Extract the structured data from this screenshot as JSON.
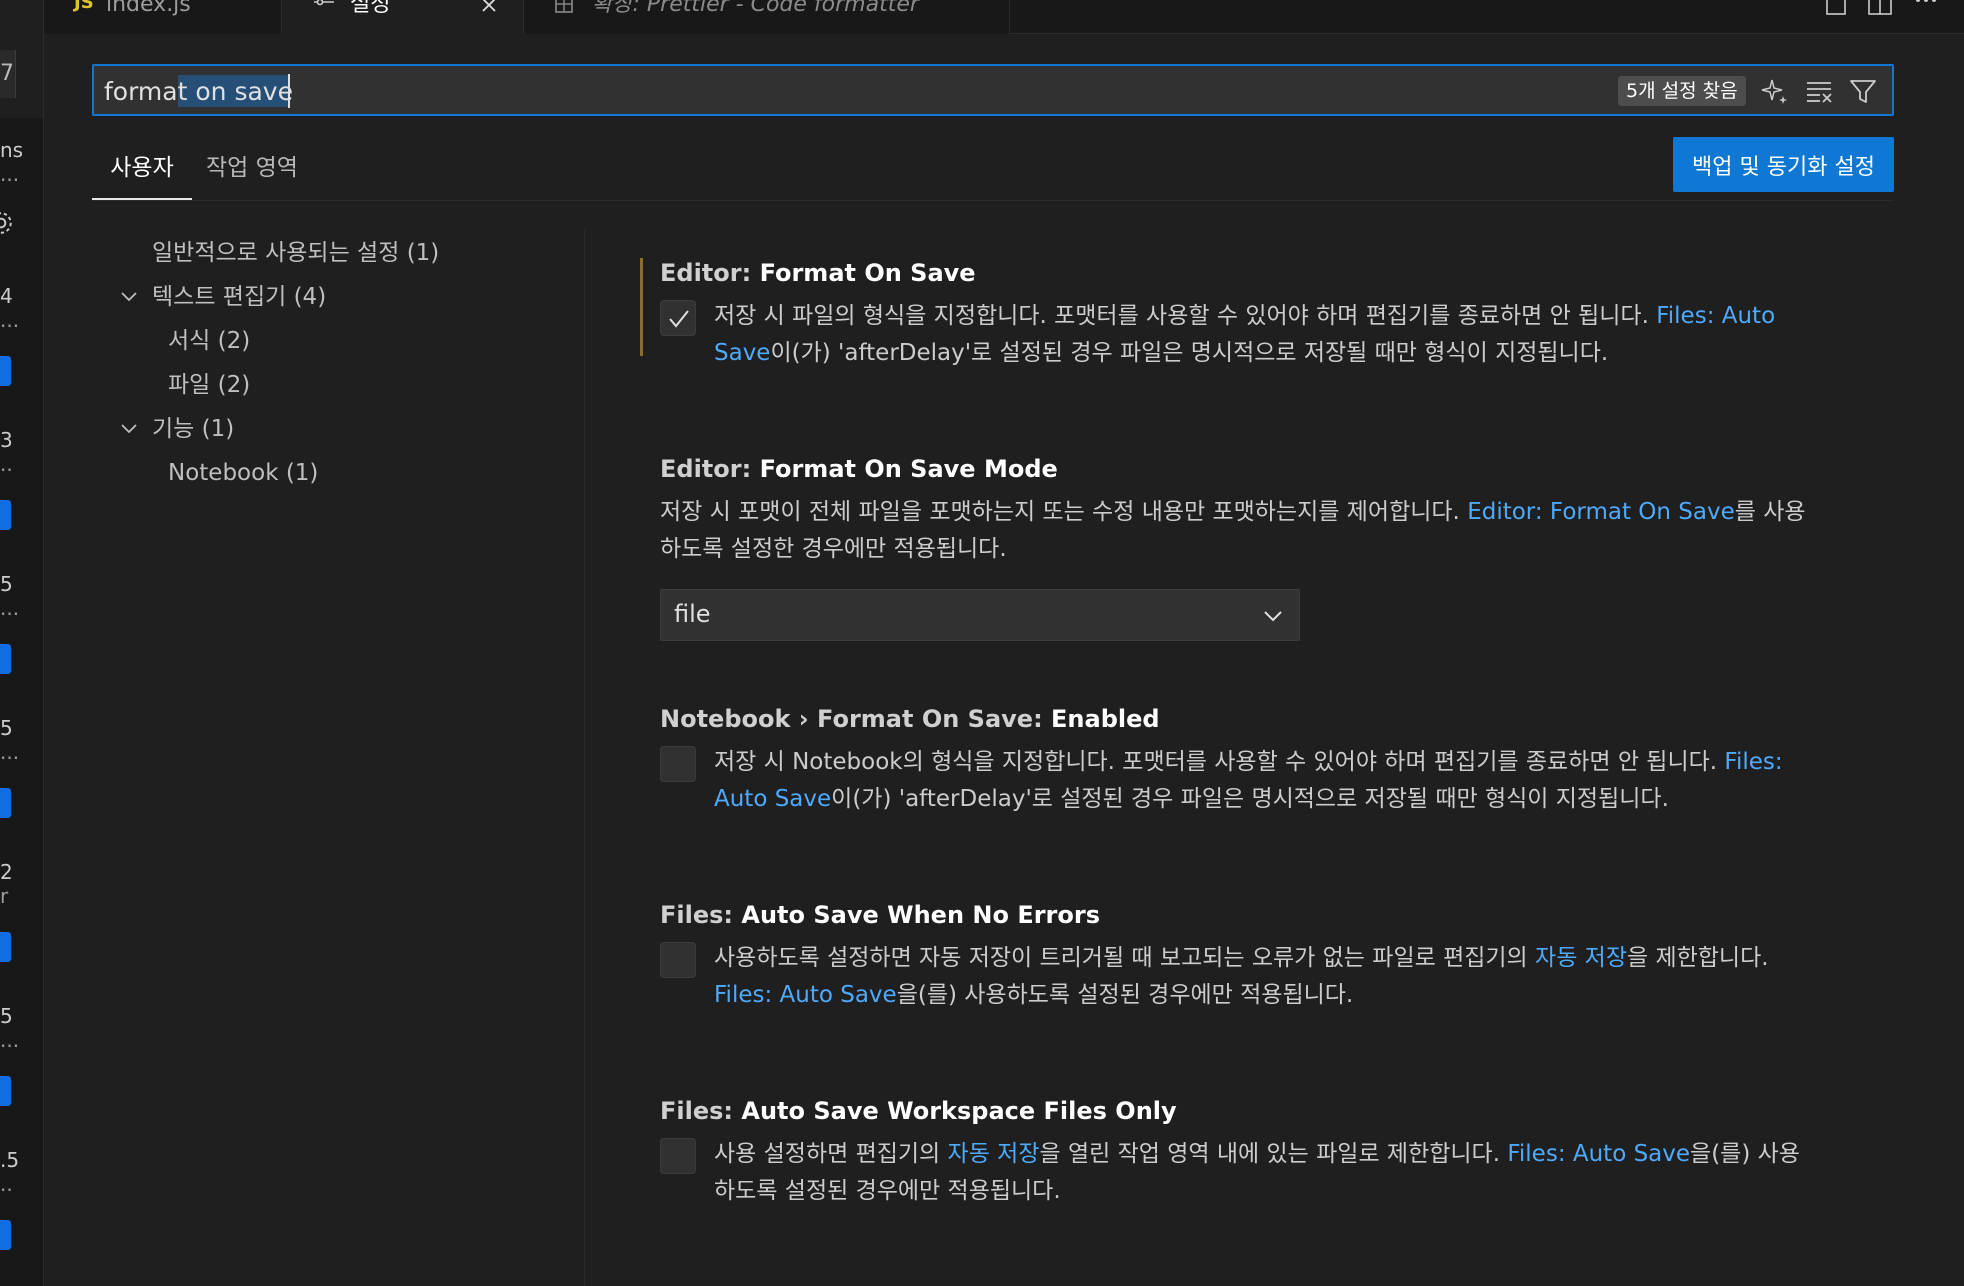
{
  "tabs": [
    {
      "icon": "JS",
      "label": "index.js"
    },
    {
      "label": "설정",
      "close_icon": "close-icon"
    },
    {
      "label": "확장: Prettier - Code formatter"
    }
  ],
  "left_strip": {
    "top_glyph": "7",
    "snippets": [
      {
        "num": "ns",
        "dots": "..."
      },
      {
        "num": "4",
        "dots": "..."
      },
      {
        "num": "3",
        "dots": ".."
      },
      {
        "num": "5",
        "dots": "..."
      },
      {
        "num": "5",
        "dots": "..."
      },
      {
        "num": "2",
        "dots": "r"
      },
      {
        "num": "5",
        "dots": "..."
      },
      {
        "num": ".5",
        "dots": ".."
      }
    ],
    "accent_color": "#0f6fe0"
  },
  "search": {
    "value": "format on save",
    "result_count": "5개 설정 찾음"
  },
  "scope_tabs": [
    {
      "label": "사용자",
      "active": true
    },
    {
      "label": "작업 영역",
      "active": false
    }
  ],
  "backup_button": "백업 및 동기화 설정",
  "toc": [
    {
      "label": "일반적으로 사용되는 설정 (1)"
    },
    {
      "label": "텍스트 편집기 (4)",
      "expanded": true
    },
    {
      "label": "서식 (2)"
    },
    {
      "label": "파일 (2)"
    },
    {
      "label": "기능 (1)",
      "expanded": true
    },
    {
      "label": "Notebook (1)"
    }
  ],
  "settings": [
    {
      "category": "Editor: ",
      "name": "Format On Save",
      "checked": true,
      "desc_line1_pre": "저장 시 파일의 형식을 지정합니다. 포맷터를 사용할 수 있어야 하며 편집기를 종료하면 안 됩니다. ",
      "desc_line1_link": "Files: Auto",
      "desc_line2_link": "Save",
      "desc_line2_post": "이(가) 'afterDelay'로 설정된 경우 파일은 명시적으로 저장될 때만 형식이 지정됩니다."
    },
    {
      "category": "Editor: ",
      "name": "Format On Save Mode",
      "desc_line1_pre": "저장 시 포맷이 전체 파일을 포맷하는지 또는 수정 내용만 포맷하는지를 제어합니다. ",
      "desc_line1_link": "Editor: Format On Save",
      "desc_line1_post": "를 사용",
      "desc_line2": "하도록 설정한 경우에만 적용됩니다.",
      "select_value": "file"
    },
    {
      "category": "Notebook › Format On Save: ",
      "name": "Enabled",
      "checked": false,
      "desc_line1_pre": "저장 시 Notebook의 형식을 지정합니다. 포맷터를 사용할 수 있어야 하며 편집기를 종료하면 안 됩니다. ",
      "desc_line1_link": "Files:",
      "desc_line2_link": "Auto Save",
      "desc_line2_post": "이(가) 'afterDelay'로 설정된 경우 파일은 명시적으로 저장될 때만 형식이 지정됩니다."
    },
    {
      "category": "Files: ",
      "name": "Auto Save When No Errors",
      "checked": false,
      "desc_line1_pre": "사용하도록 설정하면 자동 저장이 트리거될 때 보고되는 오류가 없는 파일로 편집기의 ",
      "desc_line1_link": "자동 저장",
      "desc_line1_post": "을 제한합니다.",
      "desc_line2_link": "Files: Auto Save",
      "desc_line2_post": "을(를) 사용하도록 설정된 경우에만 적용됩니다."
    },
    {
      "category": "Files: ",
      "name": "Auto Save Workspace Files Only",
      "checked": false,
      "desc_line1_pre": "사용 설정하면 편집기의 ",
      "desc_line1_link": "자동 저장",
      "desc_line1_mid": "을 열린 작업 영역 내에 있는 파일로 제한합니다. ",
      "desc_line1_link2": "Files: Auto Save",
      "desc_line1_post": "을(를) 사용",
      "desc_line2": "하도록 설정된 경우에만 적용됩니다."
    }
  ]
}
